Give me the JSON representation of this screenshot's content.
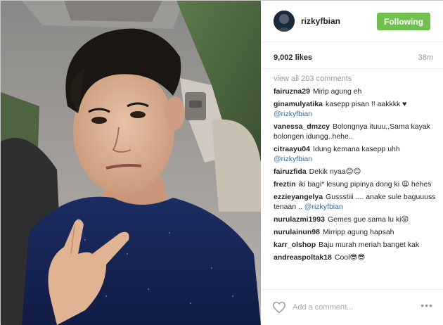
{
  "header": {
    "username": "rizkyfbian",
    "follow_label": "Following"
  },
  "stats": {
    "likes": "9,002 likes",
    "time": "38m"
  },
  "comments_panel": {
    "view_all": "view all 203 comments",
    "items": [
      {
        "user": "fairuzna29",
        "text": "Mirip agung eh",
        "mention": ""
      },
      {
        "user": "ginamulyatika",
        "text": "kasepp pisan !! aakkkk ♥",
        "mention": "@rizkyfbian"
      },
      {
        "user": "vanessa_dmzcy",
        "text": "Bolongnya ituuu,,Sama kayak bolongen idungg..hehe..",
        "mention": ""
      },
      {
        "user": "citraayu04",
        "text": "Idung kemana kasepp uhh",
        "mention": "@rizkyfbian"
      },
      {
        "user": "fairuzfida",
        "text": "Dekik nyaa😊😊",
        "mention": ""
      },
      {
        "user": "freztin",
        "text": "iki bagi* lesung pipinya dong ki 😩 hehes",
        "mention": ""
      },
      {
        "user": "ezzieyangelya",
        "text": "Gussstiii .... anake sule baguuuss tenaan ..",
        "mention": "@rizkyfbian"
      },
      {
        "user": "nurulazmi1993",
        "text": "Gemes gue sama lu ki😝",
        "mention": ""
      },
      {
        "user": "nurulainun98",
        "text": "Mirripp agung hapsah",
        "mention": ""
      },
      {
        "user": "karr_olshop",
        "text": "Baju murah meriah banget kak",
        "mention": ""
      },
      {
        "user": "andreaspoltak18",
        "text": "Cool😎😎",
        "mention": ""
      }
    ]
  },
  "add_comment": {
    "placeholder": "Add a comment...",
    "more_label": "•••"
  },
  "icons": {
    "like": "heart-outline-icon",
    "options": "more-horizontal-icon"
  },
  "colors": {
    "follow_button": "#70c050",
    "mention": "#3b6a9c",
    "muted_text": "#999999"
  }
}
